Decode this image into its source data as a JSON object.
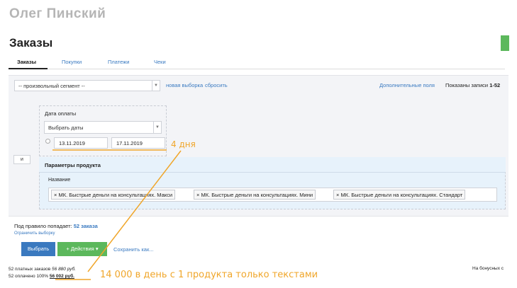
{
  "header": {
    "user_name": "Олег Пинский",
    "page_title": "Заказы"
  },
  "tabs": [
    {
      "label": "Заказы",
      "active": true
    },
    {
      "label": "Покупки",
      "active": false
    },
    {
      "label": "Платежи",
      "active": false
    },
    {
      "label": "Чеки",
      "active": false
    }
  ],
  "segment_bar": {
    "select_value": "-- произвольный сегмент --",
    "new_selection_link": "новая выборка",
    "reset_link": "сбросить",
    "extra_fields_link": "Дополнительные поля",
    "shown_prefix": "Показаны записи",
    "shown_range": "1-52"
  },
  "filters": {
    "and_button": "и",
    "payment_date_label": "Дата оплаты",
    "date_select_value": "Выбрать даты",
    "date_from": "13.11.2019",
    "date_to": "17.11.2019",
    "product_params_title": "Параметры продукта",
    "name_label": "Название",
    "tags": [
      "× МК. Быстрые деньги на консультациях. Макси",
      "× МК. Быстрые деньги на консультациях. Мини",
      "× МК. Быстрые деньги на консультациях. Стандарт"
    ]
  },
  "result": {
    "rule_prefix": "Под правило попадает:",
    "rule_count": "52 заказа",
    "limit_link": "Ограничить выборку"
  },
  "actions": {
    "choose_label": "Выбрать",
    "actions_label": "+ Действия ▾",
    "save_as_label": "Сохранить как..."
  },
  "stats": {
    "line1_prefix": "52 платных заказов",
    "line1_sum": "56 880 руб.",
    "line2_prefix": "52 оплачено 100%",
    "line2_sum": "56 002 руб.",
    "bonus_text": "На бонусных с"
  },
  "annotations": {
    "days": "4 дня",
    "income": "14 000 в день с 1 продукта только текстами",
    "color": "#f0a62a"
  },
  "colors": {
    "link": "#3a7ac1",
    "primary_button": "#3a79bf",
    "success_button": "#5cb85c"
  }
}
